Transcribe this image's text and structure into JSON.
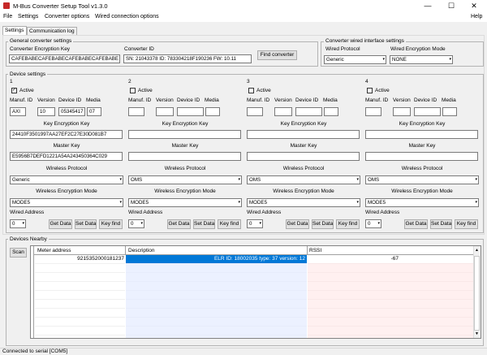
{
  "window": {
    "title": "M-Bus Converter Setup Tool v1.3.0",
    "minimize": "—",
    "maximize": "☐",
    "close": "✕"
  },
  "menu": {
    "file": "File",
    "settings": "Settings",
    "converter_options": "Converter options",
    "wired_connection_options": "Wired connection options",
    "help": "Help"
  },
  "tabs": {
    "settings": "Settings",
    "communication_log": "Communication log"
  },
  "general": {
    "group": "General converter settings",
    "enc_key_label": "Converter Encryption Key",
    "enc_key_value": "CAFEBABECAFEBABECAFEBABECAFEBABE",
    "conv_id_label": "Converter ID",
    "conv_id_value": "SN: 21043378 ID: 783304218F190236 FW: 10.11",
    "find_button": "Find converter"
  },
  "wired": {
    "group": "Converter wired interface settings",
    "protocol_label": "Wired Protocol",
    "protocol_value": "Generic",
    "enc_mode_label": "Wired Encryption Mode",
    "enc_mode_value": "NONE"
  },
  "device_settings": {
    "group": "Device settings"
  },
  "labels": {
    "active": "Active",
    "manuf_id": "Manuf. ID",
    "version": "Version",
    "device_id": "Device ID",
    "media": "Media",
    "key_enc_key": "Key Encryption Key",
    "master_key": "Master Key",
    "wireless_protocol": "Wireless Protocol",
    "wireless_enc_mode": "Wireless Encryption Mode",
    "wired_address": "Wired Address",
    "get_data": "Get Data",
    "set_data": "Set Data",
    "key_find": "Key find"
  },
  "devices": [
    {
      "num": "1",
      "active_mark": "✓",
      "manuf": "AXI",
      "version": "10",
      "device_id": "05345417",
      "media": "07",
      "kek": "24410F3501997AA27EF2C27E30D081B7",
      "master_key": "E5956B7DEFD1221A54A243450364C029",
      "protocol": "Generic",
      "enc_mode": "MODE5",
      "wired_address": "0"
    },
    {
      "num": "2",
      "active_mark": "",
      "manuf": "",
      "version": "",
      "device_id": "",
      "media": "",
      "kek": "",
      "master_key": "",
      "protocol": "OMS",
      "enc_mode": "MODE5",
      "wired_address": "0"
    },
    {
      "num": "3",
      "active_mark": "",
      "manuf": "",
      "version": "",
      "device_id": "",
      "media": "",
      "kek": "",
      "master_key": "",
      "protocol": "OMS",
      "enc_mode": "MODE5",
      "wired_address": "0"
    },
    {
      "num": "4",
      "active_mark": "",
      "manuf": "",
      "version": "",
      "device_id": "",
      "media": "",
      "kek": "",
      "master_key": "",
      "protocol": "OMS",
      "enc_mode": "MODE5",
      "wired_address": "0"
    }
  ],
  "nearby": {
    "group": "Devices Nearby",
    "scan_button": "Scan",
    "columns": {
      "meter_address": "Meter address",
      "description": "Description",
      "rssi": "RSSI"
    },
    "row": {
      "meter_address": "9215352000181237",
      "description": "ELR ID: 18002035 type: 37 version: 12",
      "rssi": "-67"
    }
  },
  "status": {
    "text": "Connected to serial [COM5]"
  },
  "icons": {
    "dropdown": "▾",
    "scroll_up": "▲",
    "scroll_down": "▼"
  }
}
